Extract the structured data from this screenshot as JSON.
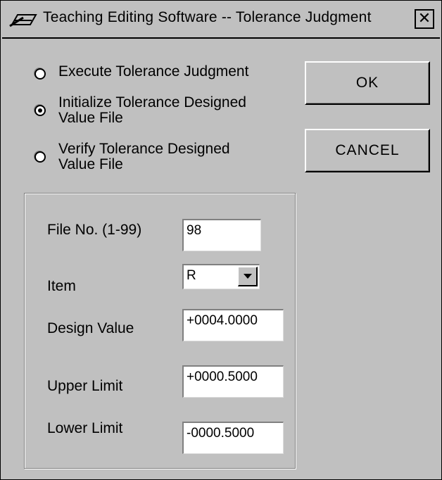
{
  "window": {
    "title": "Teaching Editing Software -- Tolerance Judgment",
    "close_label": "✕",
    "app_icon": "pen-tablet-icon"
  },
  "options": [
    {
      "label": "Execute Tolerance Judgment",
      "checked": false
    },
    {
      "label": "Initialize Tolerance Designed Value File",
      "checked": true
    },
    {
      "label": "Verify Tolerance Designed Value File",
      "checked": false
    }
  ],
  "buttons": {
    "ok": "OK",
    "cancel": "CANCEL"
  },
  "form": {
    "file_no": {
      "label": "File No. (1-99)",
      "value": "98"
    },
    "item": {
      "label": "Item",
      "value": "R"
    },
    "design_value": {
      "label": "Design Value",
      "value": "+0004.0000"
    },
    "upper_limit": {
      "label": "Upper Limit",
      "value": "+0000.5000"
    },
    "lower_limit": {
      "label": "Lower Limit",
      "value": "-0000.5000"
    }
  },
  "colors": {
    "face": "#c0c0c0",
    "shadow": "#808080",
    "highlight": "#ffffff"
  }
}
